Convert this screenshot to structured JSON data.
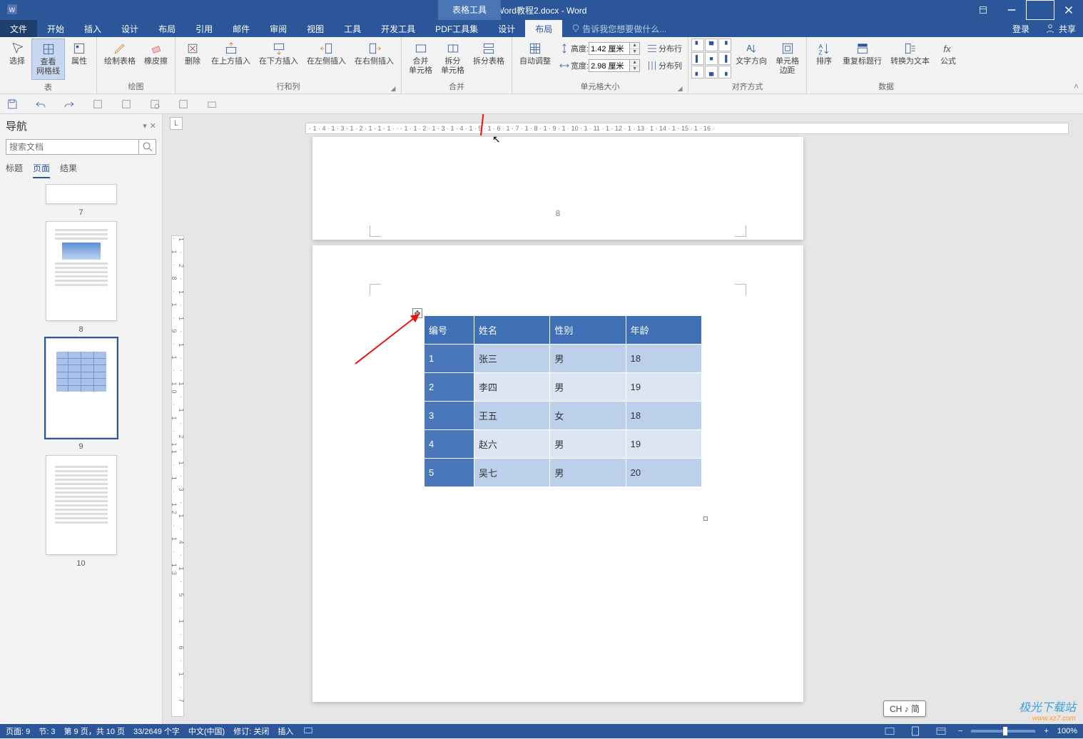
{
  "title": "Word教程2.docx - Word",
  "table_tools": "表格工具",
  "menu": {
    "file": "文件",
    "tabs": [
      "开始",
      "插入",
      "设计",
      "布局",
      "引用",
      "邮件",
      "审阅",
      "视图",
      "工具",
      "开发工具",
      "PDF工具集",
      "设计",
      "布局"
    ],
    "active_index": 12,
    "tell_me_placeholder": "告诉我您想要做什么...",
    "login": "登录",
    "share": "共享"
  },
  "ribbon": {
    "group_table": {
      "label": "表",
      "select": "选择",
      "view_gridlines": "查看\n网格线",
      "properties": "属性"
    },
    "group_draw": {
      "label": "绘图",
      "draw": "绘制表格",
      "eraser": "橡皮擦"
    },
    "group_rows": {
      "label": "行和列",
      "delete": "删除",
      "above": "在上方插入",
      "below": "在下方插入",
      "left": "在左侧插入",
      "right": "在右侧插入"
    },
    "group_merge": {
      "label": "合并",
      "merge": "合并\n单元格",
      "split": "拆分\n单元格",
      "split_table": "拆分表格"
    },
    "group_size": {
      "label": "单元格大小",
      "autofit": "自动调整",
      "height_label": "高度:",
      "height_val": "1.42 厘米",
      "width_label": "宽度:",
      "width_val": "2.98 厘米",
      "dist_rows": "分布行",
      "dist_cols": "分布列"
    },
    "group_align": {
      "label": "对齐方式",
      "text_dir": "文字方向",
      "margins": "单元格\n边距"
    },
    "group_data": {
      "label": "数据",
      "sort": "排序",
      "repeat_header": "重复标题行",
      "to_text": "转换为文本",
      "formula": "公式"
    }
  },
  "nav": {
    "title": "导航",
    "search_placeholder": "搜索文档",
    "tabs": [
      "标题",
      "页面",
      "结果"
    ],
    "active_tab": 1,
    "thumbs": [
      "7",
      "8",
      "9",
      "10"
    ],
    "selected": "9"
  },
  "ruler_h": "· 1 · 4 · 1 · 3 · 1 · 2 · 1 · 1 · 1 · · · 1 · 1 · 2 · 1 · 3 · 1 · 4 · 1 · 5 · 1 · 6 · 1 · 7 · 1 · 8 · 1 · 9 · 1 · 10 · 1 · 11 · 1 · 12 · 1 · 13 · 1 · 14 · 1 · 15 · 1 · 16 ·",
  "ruler_v": "1 · 2 · 1 · 1 · 1 · · 1 · 1 · 2 · 1 · 3 · 1 · 4 · 1 · 5 · 1 · 6 · 1 · 7 · 1 · 8 · 1 · 9 · 1 · 10 · 1 · 11 · 1 · 12 · 1 · 13",
  "ruler_corner": "L",
  "prev_page_number": "8",
  "table": {
    "headers": [
      "编号",
      "姓名",
      "性别",
      "年龄"
    ],
    "rows": [
      {
        "id": "1",
        "name": "张三",
        "gender": "男",
        "age": "18"
      },
      {
        "id": "2",
        "name": "李四",
        "gender": "男",
        "age": "19"
      },
      {
        "id": "3",
        "name": "王五",
        "gender": "女",
        "age": "18"
      },
      {
        "id": "4",
        "name": "赵六",
        "gender": "男",
        "age": "19"
      },
      {
        "id": "5",
        "name": "吴七",
        "gender": "男",
        "age": "20"
      }
    ]
  },
  "ime": "CH ♪ 简",
  "status": {
    "page": "页面: 9",
    "section": "节: 3",
    "page_of": "第 9 页，共 10 页",
    "words": "33/2649 个字",
    "lang": "中文(中国)",
    "track": "修订: 关闭",
    "insert": "插入",
    "zoom": "100%"
  },
  "watermark": {
    "brand": "极光下载站",
    "url": "www.xz7.com"
  }
}
